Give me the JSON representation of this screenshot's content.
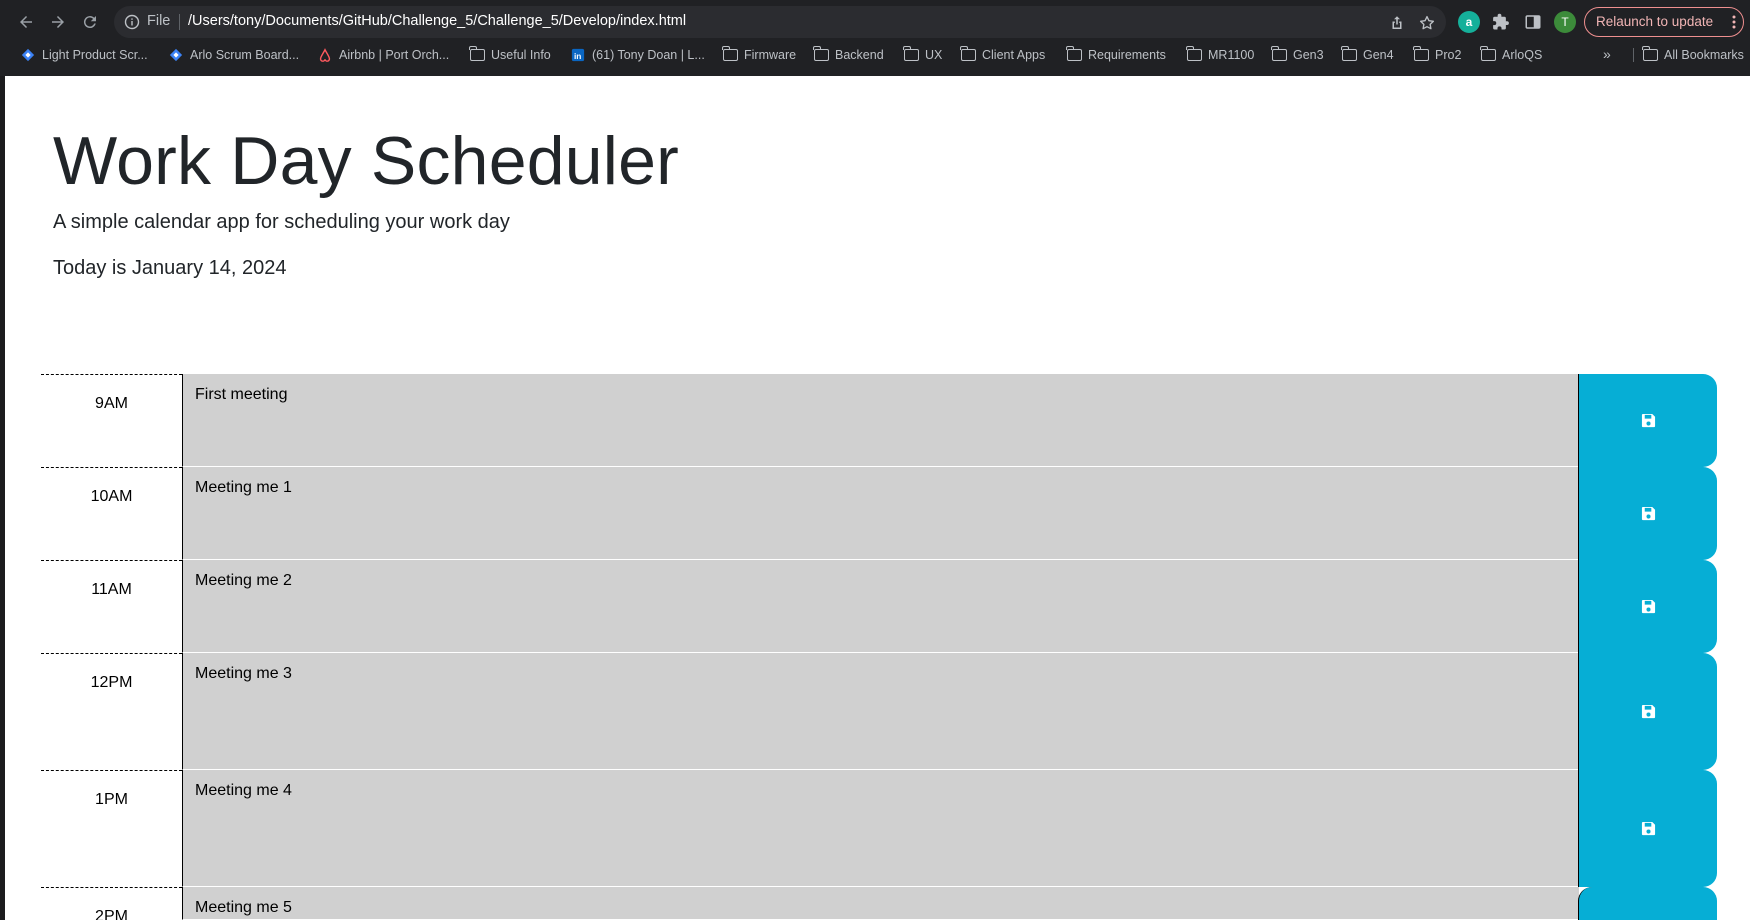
{
  "browser": {
    "omnibox": {
      "scheme_label": "File",
      "url": "/Users/tony/Documents/GitHub/Challenge_5/Challenge_5/Develop/index.html"
    },
    "profile_initial": "T",
    "extension_letter": "a",
    "relaunch_label": "Relaunch to update",
    "bookmarks": [
      {
        "label": "Light Product Scr...",
        "icon": "diamond-blue-icon"
      },
      {
        "label": "Arlo Scrum Board...",
        "icon": "diamond-blue-icon"
      },
      {
        "label": "Airbnb | Port Orch...",
        "icon": "airbnb-icon"
      },
      {
        "label": "Useful Info",
        "icon": "folder-icon"
      },
      {
        "label": "(61) Tony Doan | L...",
        "icon": "linkedin-icon"
      },
      {
        "label": "Firmware",
        "icon": "folder-icon"
      },
      {
        "label": "Backend",
        "icon": "folder-icon"
      },
      {
        "label": "UX",
        "icon": "folder-icon"
      },
      {
        "label": "Client Apps",
        "icon": "folder-icon"
      },
      {
        "label": "Requirements",
        "icon": "folder-icon"
      },
      {
        "label": "MR1100",
        "icon": "folder-icon"
      },
      {
        "label": "Gen3",
        "icon": "folder-icon"
      },
      {
        "label": "Gen4",
        "icon": "folder-icon"
      },
      {
        "label": "Pro2",
        "icon": "folder-icon"
      },
      {
        "label": "ArloQS",
        "icon": "folder-icon"
      }
    ],
    "overflow_label": "»",
    "all_bookmarks_label": "All Bookmarks"
  },
  "page": {
    "title": "Work Day Scheduler",
    "lead": "A simple calendar app for scheduling your work day",
    "today": "Today is January 14, 2024"
  },
  "schedule": [
    {
      "hour": "9AM",
      "text": "First meeting"
    },
    {
      "hour": "10AM",
      "text": "Meeting me 1"
    },
    {
      "hour": "11AM",
      "text": "Meeting me 2"
    },
    {
      "hour": "12PM",
      "text": "Meeting me 3"
    },
    {
      "hour": "1PM",
      "text": "Meeting me 4"
    },
    {
      "hour": "2PM",
      "text": "Meeting me 5"
    }
  ],
  "colors": {
    "chrome_bg": "#202124",
    "past_row": "#d0d0d0",
    "save_button": "#06aed5"
  }
}
